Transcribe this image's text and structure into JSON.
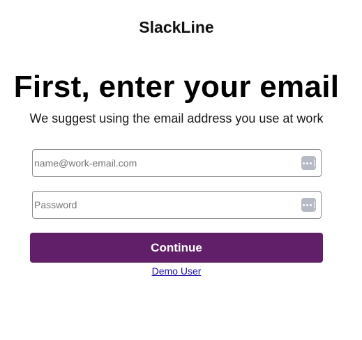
{
  "brand": {
    "name": "SlackLine"
  },
  "heading": {
    "title": "First, enter your email",
    "subtitle": "We suggest using the email address you use at work"
  },
  "form": {
    "email": {
      "placeholder": "name@work-email.com",
      "value": ""
    },
    "password": {
      "placeholder": "Password",
      "value": ""
    },
    "password_manager_icon": "password-manager-icon",
    "continue_label": "Continue",
    "demo_link_label": "Demo User"
  },
  "colors": {
    "button_bg": "#611f69",
    "button_text": "#ffffff",
    "link": "#1a0dab",
    "field_border": "#8a8a8a",
    "pm_icon_bg": "#b5bac4"
  }
}
